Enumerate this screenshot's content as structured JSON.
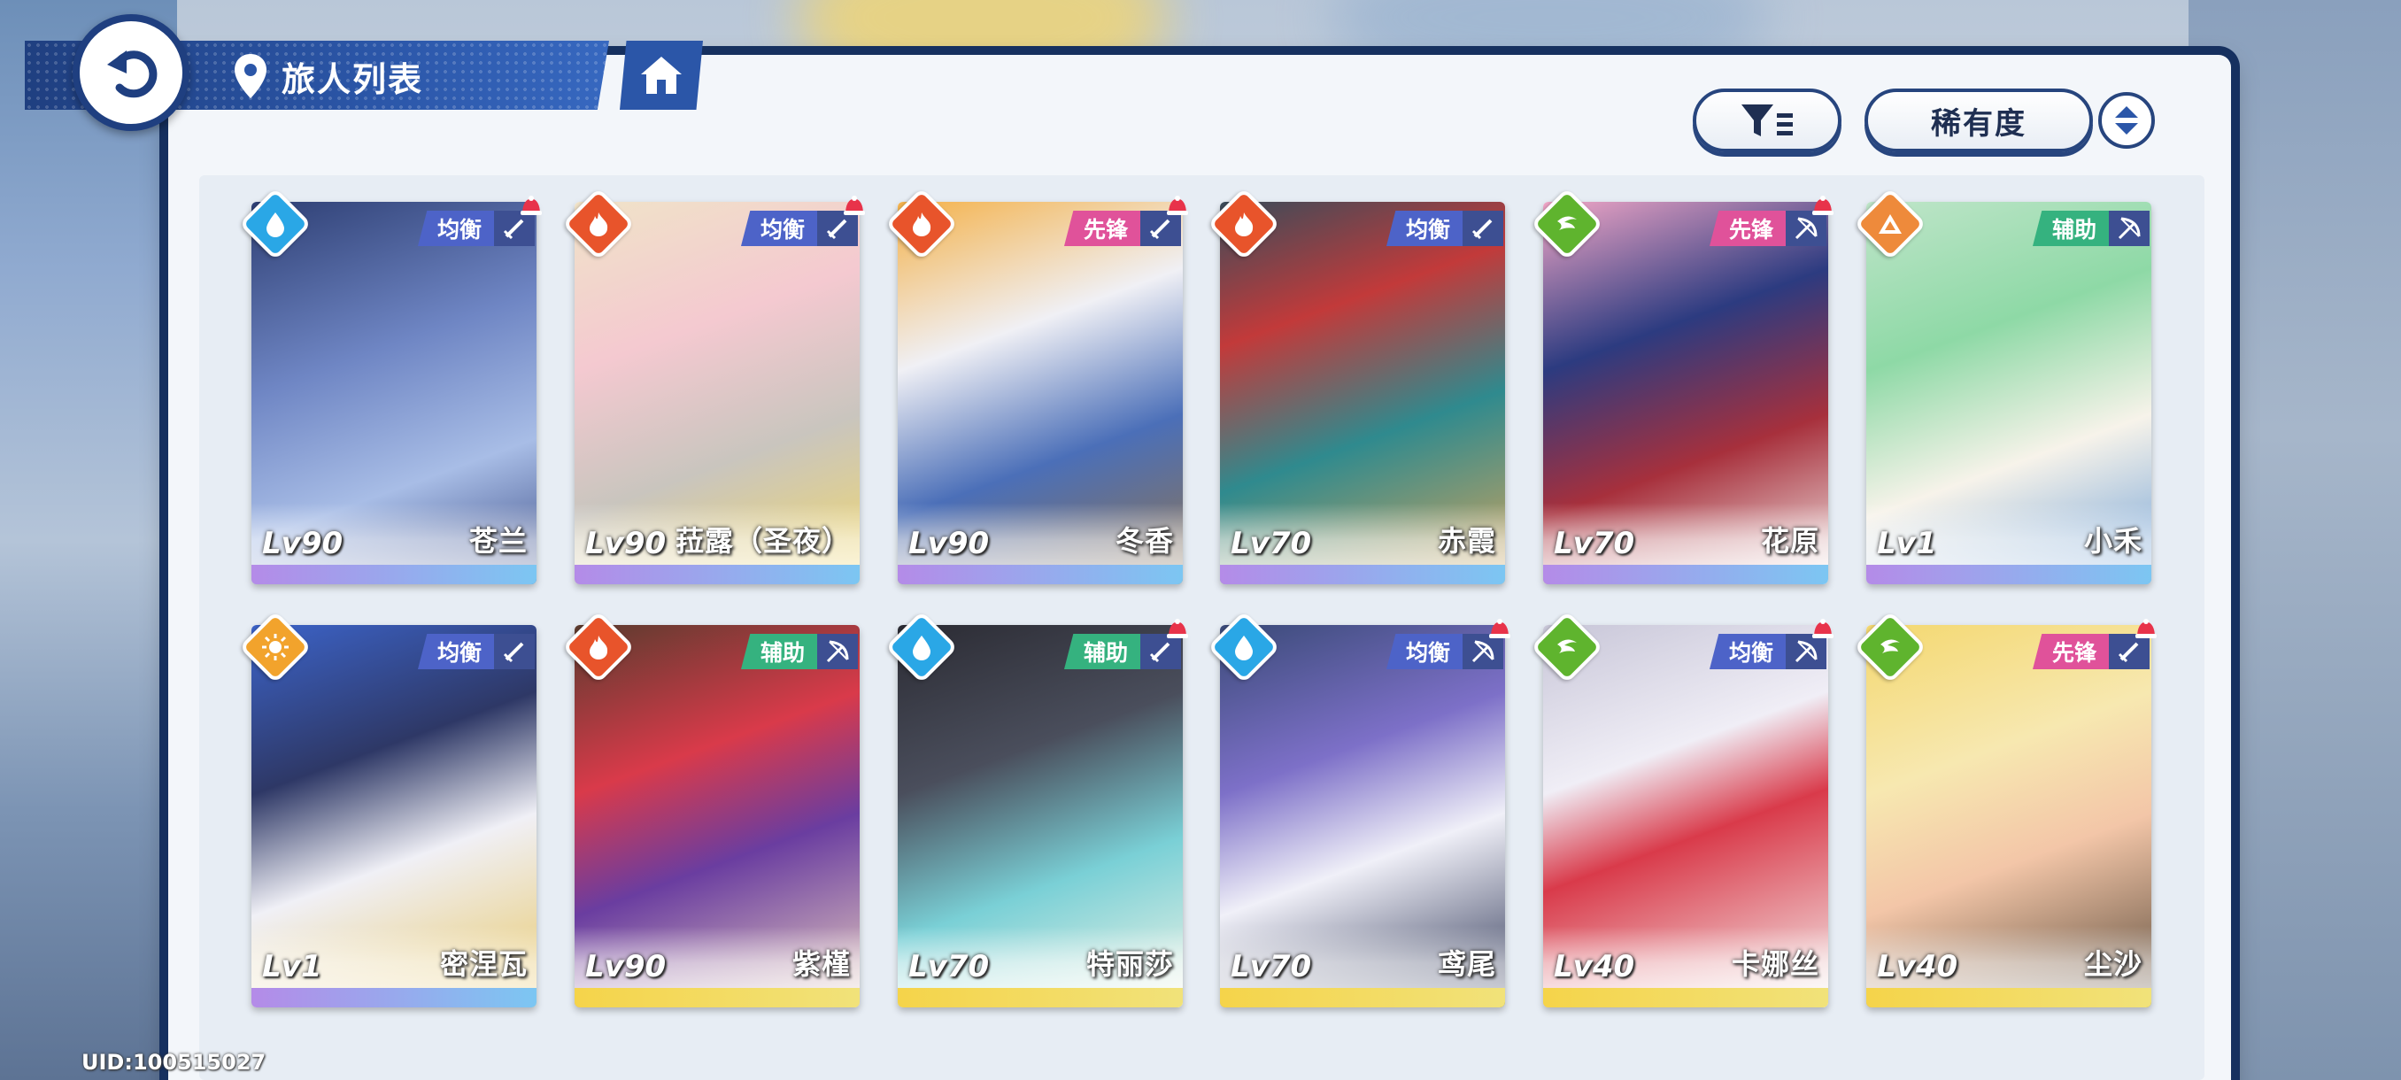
{
  "header": {
    "title": "旅人列表"
  },
  "controls": {
    "sort_label": "稀有度"
  },
  "footer": {
    "uid": "UID:100515027"
  },
  "colors": {
    "frame": "#16305f",
    "header_blue": "#2b56a8",
    "water": "#2aa7e6",
    "fire": "#e8542b",
    "wind": "#5fb42e",
    "earth": "#ee8a3b",
    "light": "#f2a32c",
    "balance": "#4d63c8",
    "vanguard": "#e0529a",
    "support": "#35b27f"
  },
  "characters": [
    {
      "level": "Lv90",
      "name": "苍兰",
      "role": "均衡",
      "element": "water",
      "weapon": "sword",
      "has_alert": true
    },
    {
      "level": "Lv90",
      "name": "菈露（圣夜）",
      "role": "均衡",
      "element": "fire",
      "weapon": "sword",
      "has_alert": true
    },
    {
      "level": "Lv90",
      "name": "冬香",
      "role": "先锋",
      "element": "fire",
      "weapon": "sword",
      "has_alert": true
    },
    {
      "level": "Lv70",
      "name": "赤霞",
      "role": "均衡",
      "element": "fire",
      "weapon": "sword",
      "has_alert": false
    },
    {
      "level": "Lv70",
      "name": "花原",
      "role": "先锋",
      "element": "wind",
      "weapon": "bow",
      "has_alert": true
    },
    {
      "level": "Lv1",
      "name": "小禾",
      "role": "辅助",
      "element": "earth",
      "weapon": "bow",
      "has_alert": false
    },
    {
      "level": "Lv1",
      "name": "密涅瓦",
      "role": "均衡",
      "element": "light",
      "weapon": "sword",
      "has_alert": false
    },
    {
      "level": "Lv90",
      "name": "紫槿",
      "role": "辅助",
      "element": "fire",
      "weapon": "bow",
      "has_alert": false
    },
    {
      "level": "Lv70",
      "name": "特丽莎",
      "role": "辅助",
      "element": "water",
      "weapon": "sword",
      "has_alert": true
    },
    {
      "level": "Lv70",
      "name": "鸢尾",
      "role": "均衡",
      "element": "water",
      "weapon": "bow",
      "has_alert": true
    },
    {
      "level": "Lv40",
      "name": "卡娜丝",
      "role": "均衡",
      "element": "wind",
      "weapon": "bow",
      "has_alert": true
    },
    {
      "level": "Lv40",
      "name": "尘沙",
      "role": "先锋",
      "element": "wind",
      "weapon": "sword",
      "has_alert": true
    }
  ]
}
